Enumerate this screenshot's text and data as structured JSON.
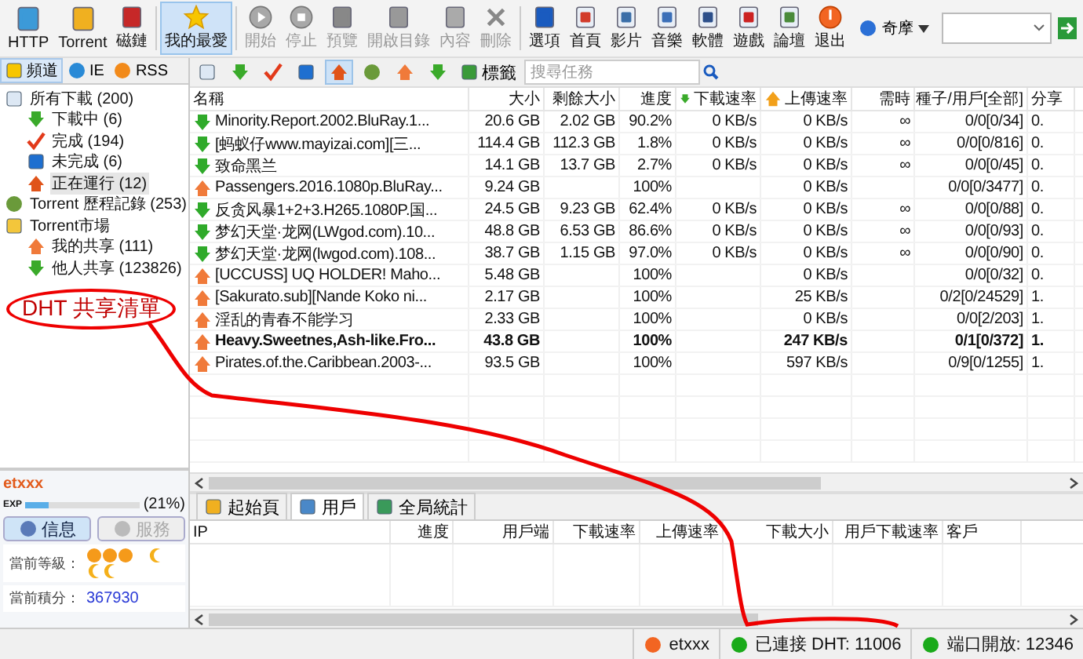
{
  "toolbar": {
    "buttons": [
      {
        "label": "HTTP",
        "disabled": false,
        "selected": false
      },
      {
        "label": "Torrent",
        "disabled": false,
        "selected": false
      },
      {
        "label": "磁鏈",
        "disabled": false,
        "selected": false
      },
      {
        "label": "我的最愛",
        "disabled": false,
        "selected": true
      },
      {
        "label": "開始",
        "disabled": true,
        "selected": false
      },
      {
        "label": "停止",
        "disabled": true,
        "selected": false
      },
      {
        "label": "預覽",
        "disabled": true,
        "selected": false
      },
      {
        "label": "開啟目錄",
        "disabled": true,
        "selected": false
      },
      {
        "label": "內容",
        "disabled": true,
        "selected": false
      },
      {
        "label": "刪除",
        "disabled": true,
        "selected": false
      },
      {
        "label": "選項",
        "disabled": false,
        "selected": false
      },
      {
        "label": "首頁",
        "disabled": false,
        "selected": false
      },
      {
        "label": "影片",
        "disabled": false,
        "selected": false
      },
      {
        "label": "音樂",
        "disabled": false,
        "selected": false
      },
      {
        "label": "軟體",
        "disabled": false,
        "selected": false
      },
      {
        "label": "遊戲",
        "disabled": false,
        "selected": false
      },
      {
        "label": "論壇",
        "disabled": false,
        "selected": false
      },
      {
        "label": "退出",
        "disabled": false,
        "selected": false
      }
    ],
    "search_engine": "奇摩"
  },
  "sidebar": {
    "tabs": [
      {
        "label": "頻道",
        "selected": true
      },
      {
        "label": "IE",
        "selected": false
      },
      {
        "label": "RSS",
        "selected": false
      }
    ],
    "tree": [
      {
        "label": "所有下載 (200)",
        "selected": false,
        "children": [
          {
            "label": "下載中 (6)",
            "selected": false
          },
          {
            "label": "完成 (194)",
            "selected": false
          },
          {
            "label": "未完成 (6)",
            "selected": false
          },
          {
            "label": "正在運行 (12)",
            "selected": true
          }
        ]
      },
      {
        "label": "Torrent 歷程記錄 (253)",
        "selected": false
      },
      {
        "label": "Torrent市場",
        "selected": false,
        "children": [
          {
            "label": "我的共享 (111)",
            "selected": false
          },
          {
            "label": "他人共享 (123826)",
            "selected": false
          }
        ]
      }
    ],
    "annotation": "DHT 共享清單",
    "user": {
      "name": "etxxx",
      "exp_label": "EXP",
      "level": 0.21,
      "percent": "(21%)",
      "tabs": [
        {
          "label": "信息",
          "selected": true
        },
        {
          "label": "服務",
          "selected": false
        }
      ],
      "rank_label": "當前等級：",
      "points_label": "當前積分：",
      "points": "367930"
    }
  },
  "task_toolbar": {
    "buttons": [
      {
        "selected": false
      },
      {
        "selected": false
      },
      {
        "selected": false
      },
      {
        "selected": false
      },
      {
        "selected": true
      },
      {
        "selected": false
      },
      {
        "selected": false
      },
      {
        "selected": false
      }
    ],
    "tag_button": "標籤",
    "search": {
      "placeholder": "搜尋任務"
    }
  },
  "tasks": {
    "columns": [
      "名稱",
      "大小",
      "剩餘大小",
      "進度",
      "下載速率",
      "上傳速率",
      "需時",
      "種子/用戶[全部]",
      "分享"
    ],
    "rows": [
      {
        "kind": "down",
        "bold": false,
        "name": "Minority.Report.2002.BluRay.1...",
        "size": "20.6 GB",
        "remaining": "2.02 GB",
        "progress": "90.2%",
        "down": "0 KB/s",
        "up": "0 KB/s",
        "eta": "∞",
        "peers": "0/0[0/34]",
        "share": "0."
      },
      {
        "kind": "down",
        "bold": false,
        "name": "[蚂蚁仔www.mayizai.com][三...",
        "size": "114.4 GB",
        "remaining": "112.3 GB",
        "progress": "1.8%",
        "down": "0 KB/s",
        "up": "0 KB/s",
        "eta": "∞",
        "peers": "0/0[0/816]",
        "share": "0."
      },
      {
        "kind": "down",
        "bold": false,
        "name": "致命黑兰",
        "size": "14.1 GB",
        "remaining": "13.7 GB",
        "progress": "2.7%",
        "down": "0 KB/s",
        "up": "0 KB/s",
        "eta": "∞",
        "peers": "0/0[0/45]",
        "share": "0."
      },
      {
        "kind": "up",
        "bold": false,
        "name": "Passengers.2016.1080p.BluRay...",
        "size": "9.24 GB",
        "progress": "100%",
        "up": "0 KB/s",
        "peers": "0/0[0/3477]",
        "share": "0."
      },
      {
        "kind": "down",
        "bold": false,
        "name": "反贪风暴1+2+3.H265.1080P.国...",
        "size": "24.5 GB",
        "remaining": "9.23 GB",
        "progress": "62.4%",
        "down": "0 KB/s",
        "up": "0 KB/s",
        "eta": "∞",
        "peers": "0/0[0/88]",
        "share": "0."
      },
      {
        "kind": "down",
        "bold": false,
        "name": "梦幻天堂·龙网(LWgod.com).10...",
        "size": "48.8 GB",
        "remaining": "6.53 GB",
        "progress": "86.6%",
        "down": "0 KB/s",
        "up": "0 KB/s",
        "eta": "∞",
        "peers": "0/0[0/93]",
        "share": "0."
      },
      {
        "kind": "down",
        "bold": false,
        "name": "梦幻天堂·龙网(lwgod.com).108...",
        "size": "38.7 GB",
        "remaining": "1.15 GB",
        "progress": "97.0%",
        "down": "0 KB/s",
        "up": "0 KB/s",
        "eta": "∞",
        "peers": "0/0[0/90]",
        "share": "0."
      },
      {
        "kind": "up",
        "bold": false,
        "name": "[UCCUSS] UQ HOLDER! Maho...",
        "size": "5.48 GB",
        "progress": "100%",
        "up": "0 KB/s",
        "peers": "0/0[0/32]",
        "share": "0."
      },
      {
        "kind": "up",
        "bold": false,
        "name": "[Sakurato.sub][Nande Koko ni...",
        "size": "2.17 GB",
        "progress": "100%",
        "up": "25 KB/s",
        "peers": "0/2[0/24529]",
        "share": "1."
      },
      {
        "kind": "up",
        "bold": false,
        "name": "淫乱的青春不能学习",
        "size": "2.33 GB",
        "progress": "100%",
        "up": "0 KB/s",
        "peers": "0/0[2/203]",
        "share": "1."
      },
      {
        "kind": "up",
        "bold": true,
        "name": "Heavy.Sweetnes,Ash-like.Fro...",
        "size": "43.8 GB",
        "progress": "100%",
        "up": "247 KB/s",
        "peers": "0/1[0/372]",
        "share": "1."
      },
      {
        "kind": "up",
        "bold": false,
        "name": "Pirates.of.the.Caribbean.2003-...",
        "size": "93.5 GB",
        "progress": "100%",
        "up": "597 KB/s",
        "peers": "0/9[0/1255]",
        "share": "1."
      }
    ]
  },
  "detail": {
    "tabs": [
      {
        "label": "起始頁",
        "selected": false
      },
      {
        "label": "用戶",
        "selected": true
      },
      {
        "label": "全局統計",
        "selected": false
      }
    ],
    "columns": [
      "IP",
      "進度",
      "用戶端",
      "下載速率",
      "上傳速率",
      "下載大小",
      "用戶下載速率",
      "客戶"
    ]
  },
  "status_bar": {
    "user": "etxxx",
    "dht": "已連接 DHT: 11006",
    "port": "端口開放: 12346"
  }
}
